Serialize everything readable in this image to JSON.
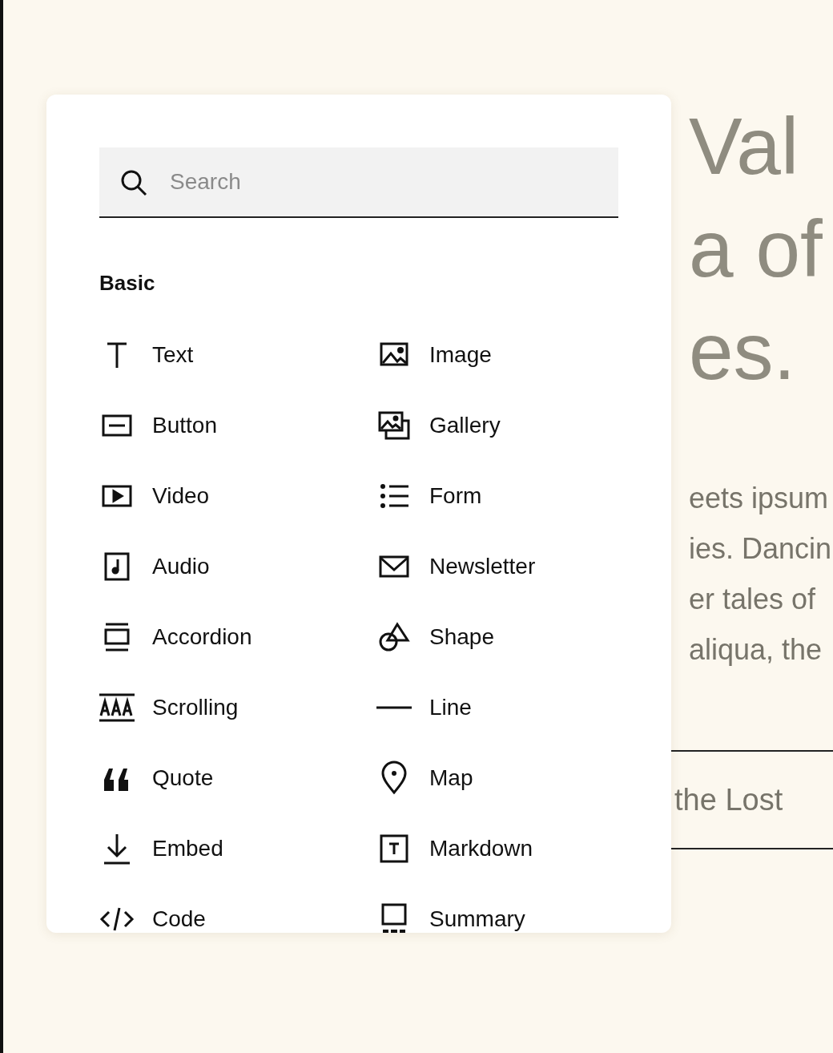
{
  "panel": {
    "search": {
      "placeholder": "Search"
    },
    "section": {
      "title": "Basic"
    },
    "items": [
      {
        "label": "Text"
      },
      {
        "label": "Image"
      },
      {
        "label": "Button"
      },
      {
        "label": "Gallery"
      },
      {
        "label": "Video"
      },
      {
        "label": "Form"
      },
      {
        "label": "Audio"
      },
      {
        "label": "Newsletter"
      },
      {
        "label": "Accordion"
      },
      {
        "label": "Shape"
      },
      {
        "label": "Scrolling"
      },
      {
        "label": "Line"
      },
      {
        "label": "Quote"
      },
      {
        "label": "Map"
      },
      {
        "label": "Embed"
      },
      {
        "label": "Markdown"
      },
      {
        "label": "Code"
      },
      {
        "label": "Summary"
      }
    ]
  },
  "background": {
    "heading_lines": [
      "Val",
      "a of",
      "es."
    ],
    "body_lines": [
      "eets ipsum",
      "ies. Dancin",
      "er tales of",
      "aliqua, the"
    ],
    "link": "the Lost"
  }
}
